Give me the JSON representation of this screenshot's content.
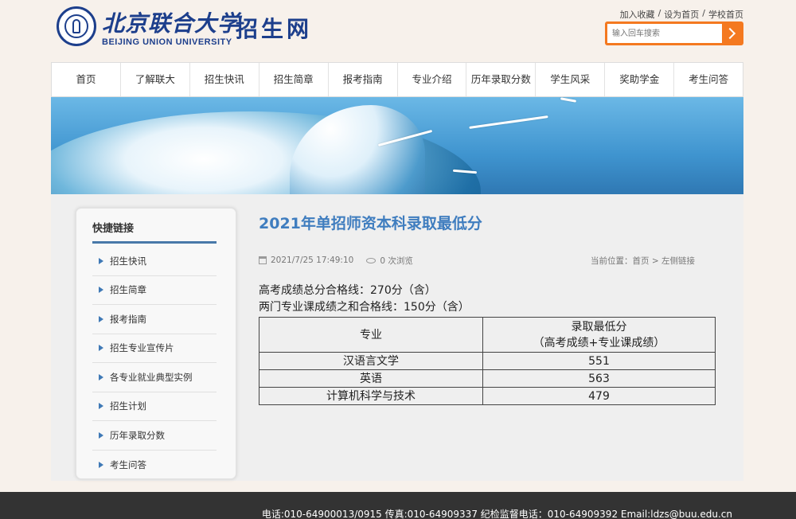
{
  "header": {
    "logo_cn": "北京联合大学",
    "logo_en": "BEIJING UNION UNIVERSITY",
    "site_title": "招生网",
    "toplinks": [
      "加入收藏",
      "设为首页",
      "学校首页"
    ],
    "search_placeholder": "输入回车搜索"
  },
  "nav": [
    "首页",
    "了解联大",
    "招生快讯",
    "招生简章",
    "报考指南",
    "专业介绍",
    "历年录取分数",
    "学生风采",
    "奖助学金",
    "考生问答"
  ],
  "sidebar": {
    "title": "快捷链接",
    "items": [
      "招生快讯",
      "招生简章",
      "报考指南",
      "招生专业宣传片",
      "各专业就业典型实例",
      "招生计划",
      "历年录取分数",
      "考生问答"
    ]
  },
  "article": {
    "title": "2021年单招师资本科录取最低分",
    "date": "2021/7/25 17:49:10",
    "views": "0 次浏览",
    "breadcrumb": "当前位置：首页 > 左侧链接",
    "line1": "高考成绩总分合格线：270分（含）",
    "line2": "两门专业课成绩之和合格线：150分（含）",
    "table": {
      "col1": "专业",
      "col2_line1": "录取最低分",
      "col2_line2": "（高考成绩+专业课成绩）",
      "rows": [
        {
          "major": "汉语言文学",
          "score": "551"
        },
        {
          "major": "英语",
          "score": "563"
        },
        {
          "major": "计算机科学与技术",
          "score": "479"
        }
      ]
    }
  },
  "footer": {
    "text": "电话:010-64900013/0915   传真:010-64909337   纪检监督电话：010-64909392   Email:ldzs@buu.edu.cn"
  }
}
